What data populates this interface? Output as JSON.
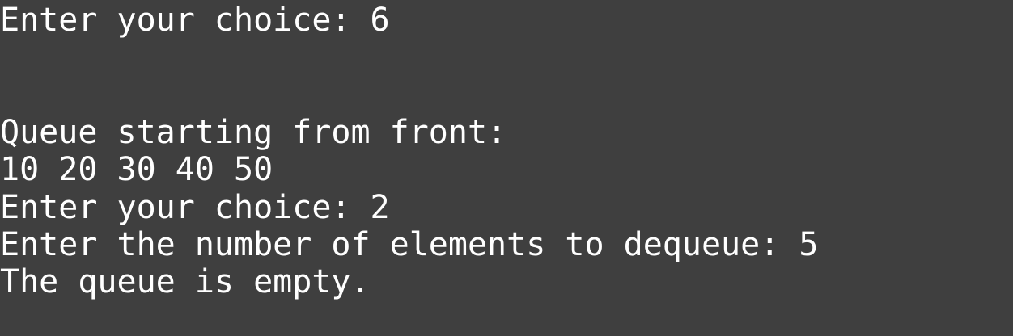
{
  "terminal": {
    "lines": [
      "Enter your choice: 6",
      "Queue starting from front:",
      "10 20 30 40 50",
      "Enter your choice: 2",
      "Enter the number of elements to dequeue: 5",
      "The queue is empty."
    ]
  }
}
